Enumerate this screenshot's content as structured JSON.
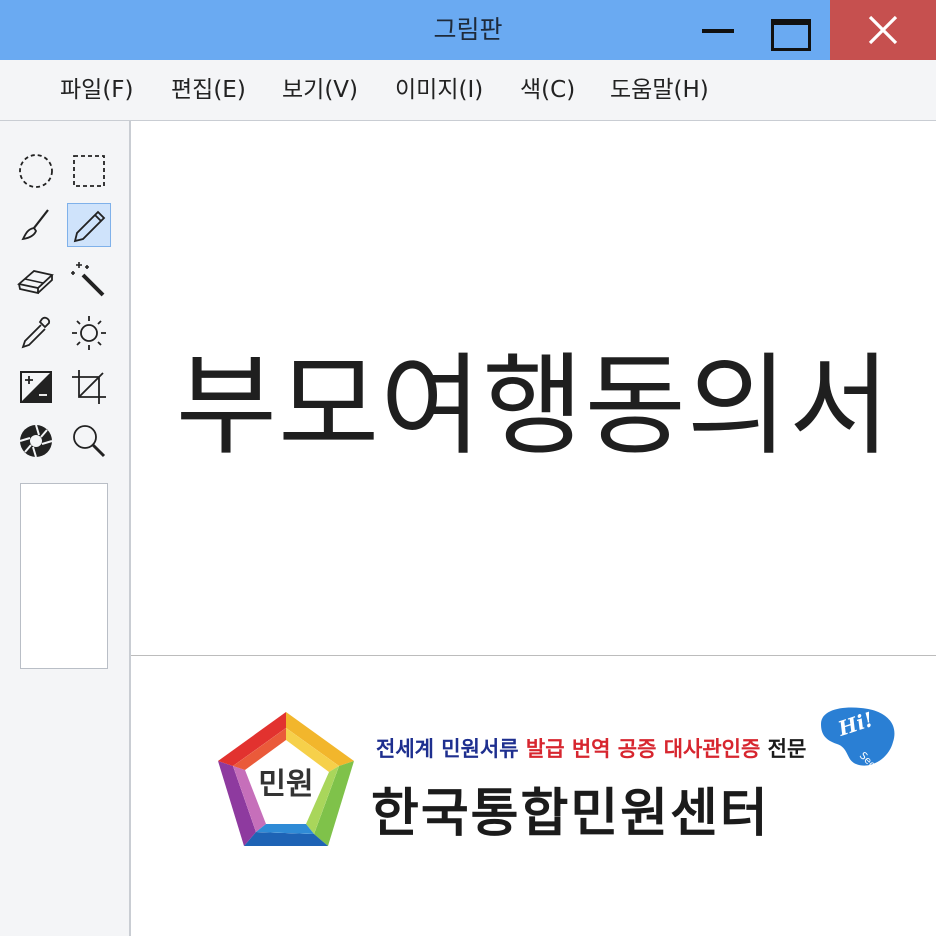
{
  "window": {
    "title": "그림판"
  },
  "menu": {
    "items": [
      "파일(F)",
      "편집(E)",
      "보기(V)",
      "이미지(I)",
      "색(C)",
      "도움말(H)"
    ]
  },
  "tools": [
    {
      "name": "ellipse-select-icon"
    },
    {
      "name": "rect-select-icon"
    },
    {
      "name": "brush-icon"
    },
    {
      "name": "pencil-icon",
      "active": true
    },
    {
      "name": "eraser-icon"
    },
    {
      "name": "magic-wand-icon"
    },
    {
      "name": "color-picker-icon"
    },
    {
      "name": "brightness-icon"
    },
    {
      "name": "contrast-icon"
    },
    {
      "name": "crop-icon"
    },
    {
      "name": "aperture-icon"
    },
    {
      "name": "zoom-icon"
    }
  ],
  "canvas": {
    "headline": "부모여행동의서",
    "logo": {
      "badge": "민원",
      "tagline_part1": "전세계 민원서류 ",
      "tagline_part2": "발급 번역 공증 대사관인증",
      "tagline_part3": " 전문",
      "name": "한국통합민원센터",
      "hiseoul_text": "Hi!",
      "hiseoul_sub": "Seoul"
    }
  },
  "colors": {
    "titlebar": "#6aaaf2",
    "close_button": "#c6504f",
    "tagline_blue": "#1e2f8f",
    "tagline_red": "#d7262f"
  }
}
